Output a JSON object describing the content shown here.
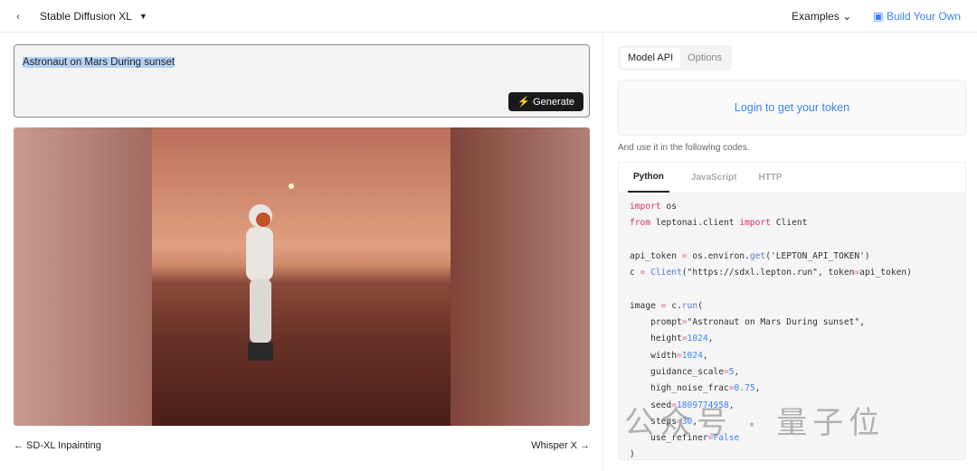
{
  "header": {
    "back_icon": "chevron-left-icon",
    "model": "Stable Diffusion XL",
    "examples": "Examples",
    "build": "Build Your Own"
  },
  "prompt": {
    "value": "Astronaut on Mars During sunset",
    "generate": "Generate"
  },
  "footer": {
    "prev": "← SD-XL Inpainting",
    "next": "Whisper X →"
  },
  "api": {
    "tabs": [
      "Model API",
      "Options"
    ],
    "login": "Login to get your token",
    "hint": "And use it in the following codes.",
    "code_tabs": [
      "Python",
      "JavaScript",
      "HTTP"
    ],
    "code": [
      [
        [
          "import",
          "kw"
        ],
        [
          " os",
          ""
        ]
      ],
      [
        [
          "from",
          "kw"
        ],
        [
          " leptonai.client ",
          ""
        ],
        [
          "import",
          "kw"
        ],
        [
          " Client",
          ""
        ]
      ],
      [],
      [
        [
          "api_token ",
          ""
        ],
        [
          "=",
          "op"
        ],
        [
          " os.environ.",
          ""
        ],
        [
          "get",
          "fn"
        ],
        [
          "('LEPTON_API_TOKEN')",
          ""
        ]
      ],
      [
        [
          "c ",
          ""
        ],
        [
          "=",
          "op"
        ],
        [
          " ",
          ""
        ],
        [
          "Client",
          "fn"
        ],
        [
          "(\"https://sdxl.lepton.run\", token",
          ""
        ],
        [
          "=",
          "op"
        ],
        [
          "api_token)",
          ""
        ]
      ],
      [],
      [
        [
          "image ",
          ""
        ],
        [
          "=",
          "op"
        ],
        [
          " c.",
          ""
        ],
        [
          "run",
          "fn"
        ],
        [
          "(",
          ""
        ]
      ],
      [
        [
          "    prompt",
          ""
        ],
        [
          "=",
          "op"
        ],
        [
          "\"Astronaut on Mars During sunset\",",
          ""
        ]
      ],
      [
        [
          "    height",
          ""
        ],
        [
          "=",
          "op"
        ],
        [
          "1024",
          "num"
        ],
        [
          ",",
          ""
        ]
      ],
      [
        [
          "    width",
          ""
        ],
        [
          "=",
          "op"
        ],
        [
          "1024",
          "num"
        ],
        [
          ",",
          ""
        ]
      ],
      [
        [
          "    guidance_scale",
          ""
        ],
        [
          "=",
          "op"
        ],
        [
          "5",
          "num"
        ],
        [
          ",",
          ""
        ]
      ],
      [
        [
          "    high_noise_frac",
          ""
        ],
        [
          "=",
          "op"
        ],
        [
          "0.75",
          "num"
        ],
        [
          ",",
          ""
        ]
      ],
      [
        [
          "    seed",
          ""
        ],
        [
          "=",
          "op"
        ],
        [
          "1809774958",
          "num"
        ],
        [
          ",",
          ""
        ]
      ],
      [
        [
          "    steps",
          ""
        ],
        [
          "=",
          "op"
        ],
        [
          "30",
          "num"
        ],
        [
          ",",
          ""
        ]
      ],
      [
        [
          "    use_refiner",
          ""
        ],
        [
          "=",
          "op"
        ],
        [
          "False",
          "num"
        ]
      ],
      [
        [
          ")",
          ""
        ]
      ]
    ]
  },
  "watermark": "公众号 · 量子位"
}
